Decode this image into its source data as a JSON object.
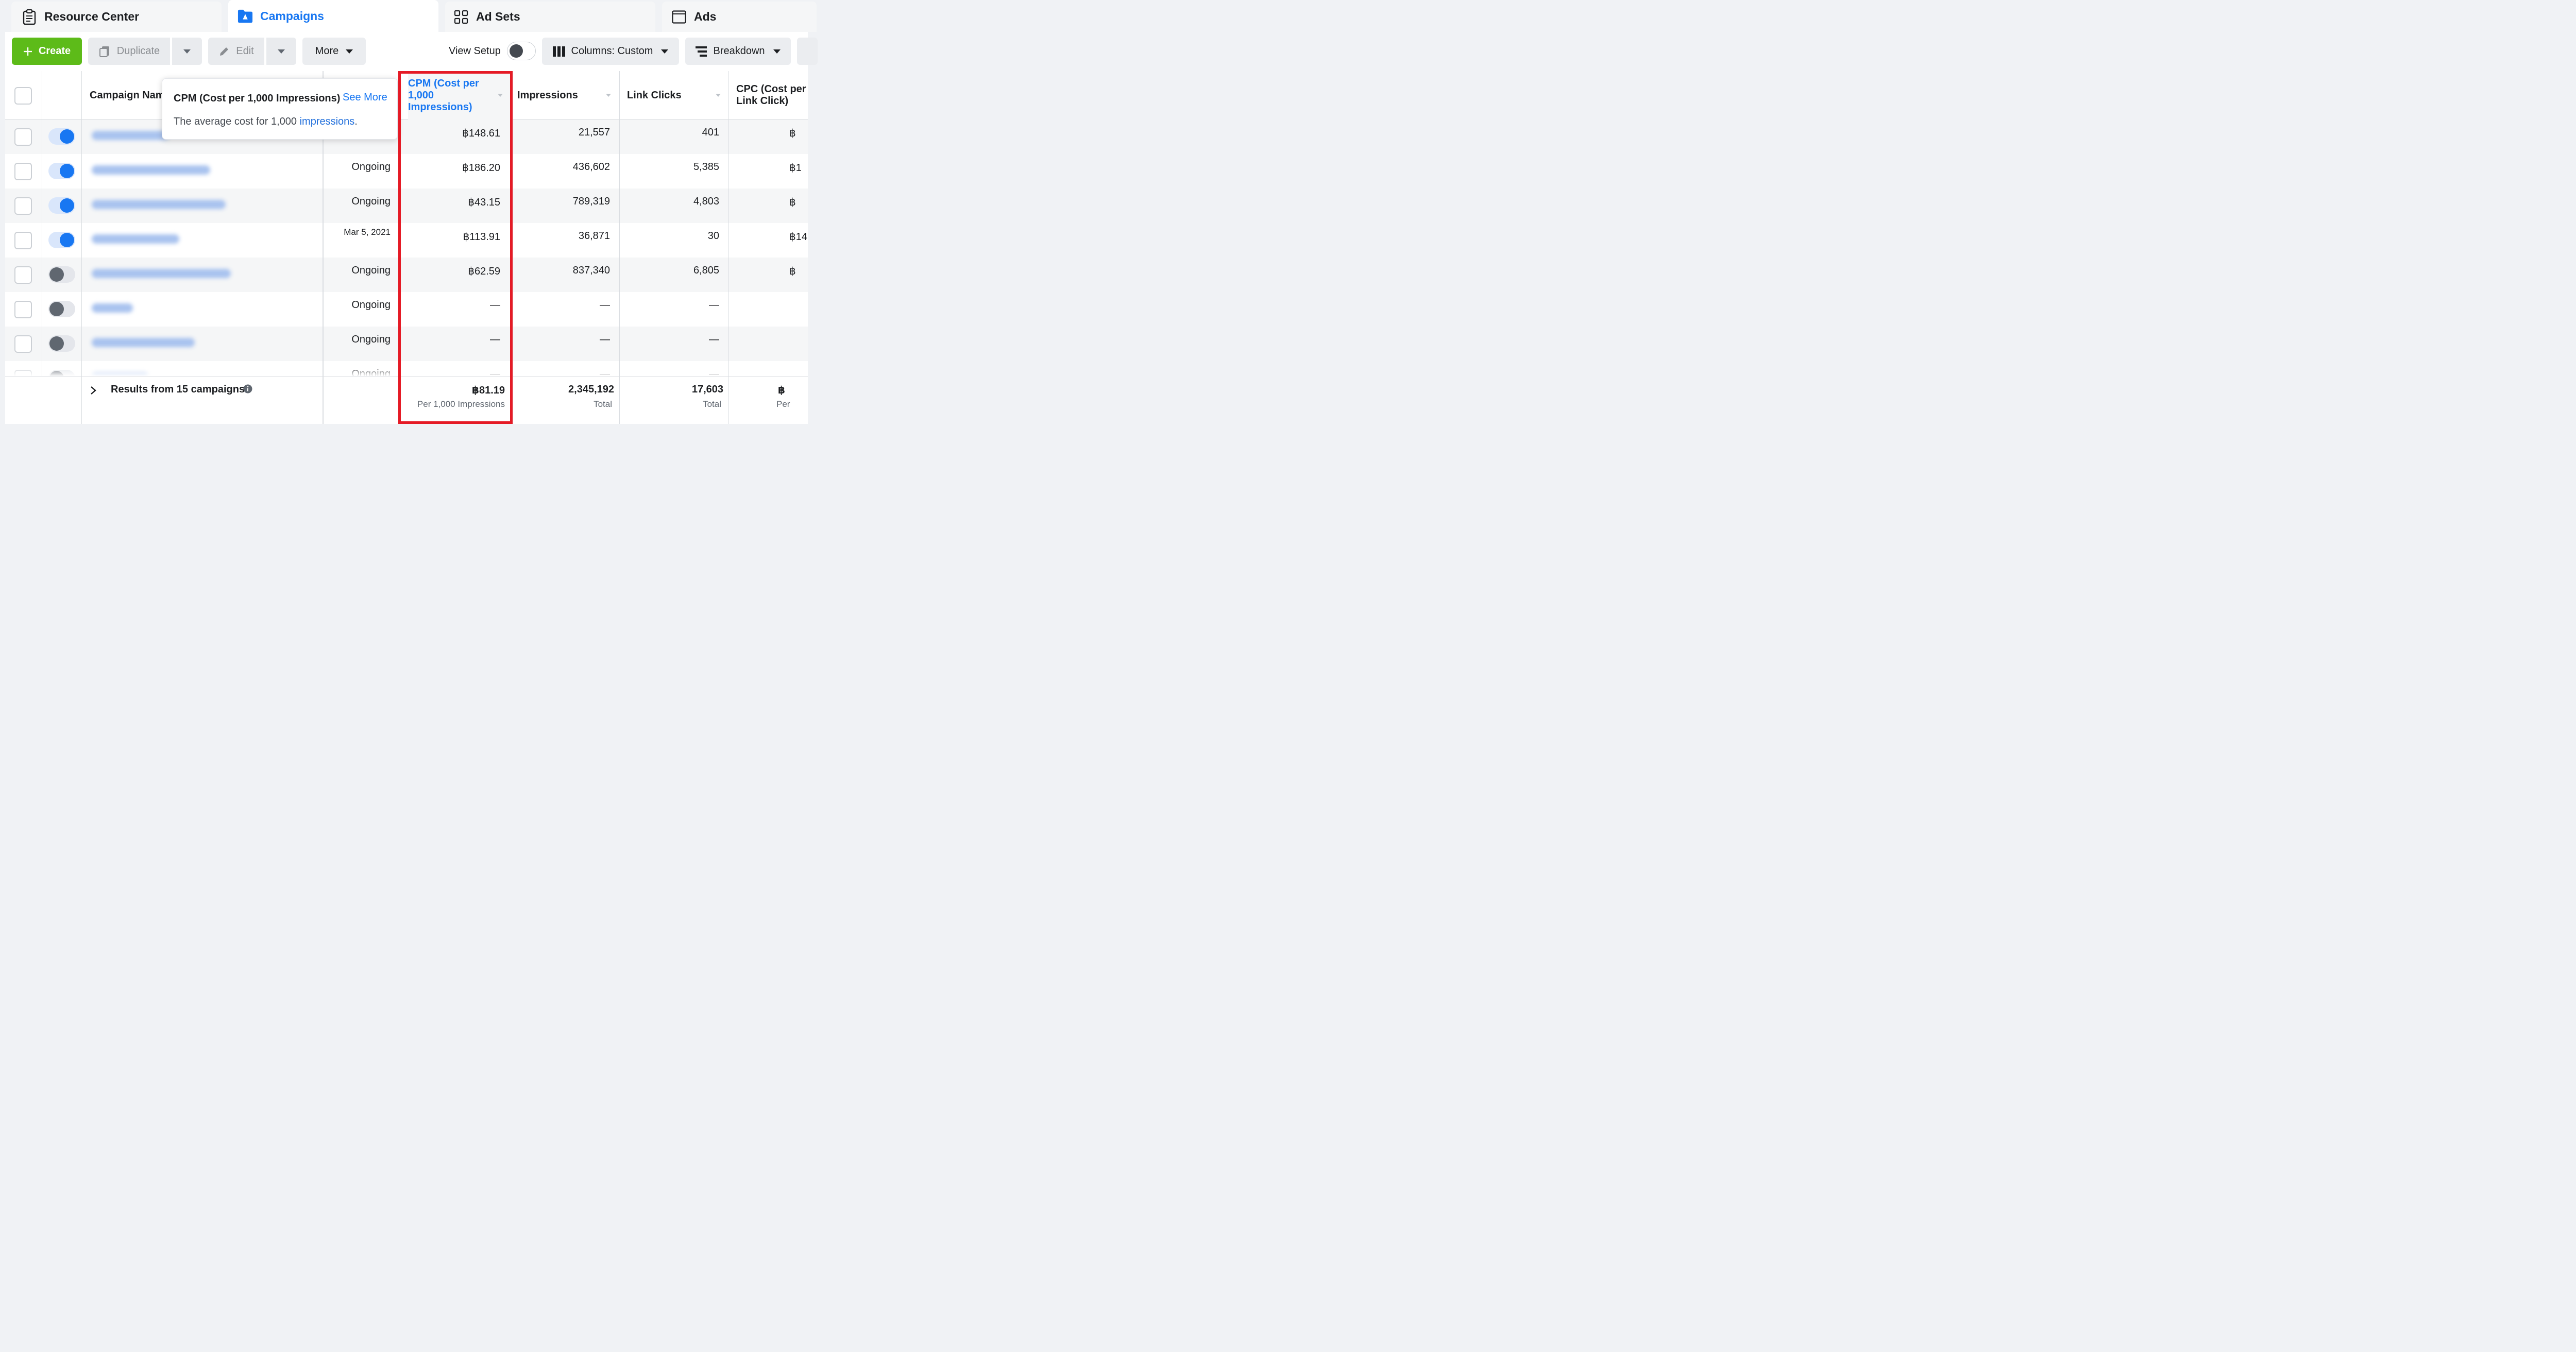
{
  "tabs": [
    {
      "label": "Resource Center",
      "icon": "clipboard-icon"
    },
    {
      "label": "Campaigns",
      "icon": "folder-icon"
    },
    {
      "label": "Ad Sets",
      "icon": "grid-icon"
    },
    {
      "label": "Ads",
      "icon": "window-icon"
    }
  ],
  "toolbar": {
    "create": "Create",
    "duplicate": "Duplicate",
    "edit": "Edit",
    "more": "More",
    "view_setup": "View Setup",
    "columns": "Columns: Custom",
    "breakdown": "Breakdown"
  },
  "table": {
    "headers": {
      "campaign_name": "Campaign Nam",
      "cpm": "CPM (Cost per 1,000 Impressions)",
      "impressions": "Impressions",
      "link_clicks": "Link Clicks",
      "cpc": "CPC (Cost per Link Click)"
    },
    "rows": [
      {
        "status": "",
        "cpm": "฿148.61",
        "impressions": "21,557",
        "link_clicks": "401",
        "cpc": "฿",
        "on": true
      },
      {
        "status": "Ongoing",
        "cpm": "฿186.20",
        "impressions": "436,602",
        "link_clicks": "5,385",
        "cpc": "฿1",
        "on": true
      },
      {
        "status": "Ongoing",
        "cpm": "฿43.15",
        "impressions": "789,319",
        "link_clicks": "4,803",
        "cpc": "฿",
        "on": true
      },
      {
        "status": "Mar 5, 2021",
        "cpm": "฿113.91",
        "impressions": "36,871",
        "link_clicks": "30",
        "cpc": "฿14",
        "on": true
      },
      {
        "status": "Ongoing",
        "cpm": "฿62.59",
        "impressions": "837,340",
        "link_clicks": "6,805",
        "cpc": "฿",
        "on": false
      },
      {
        "status": "Ongoing",
        "cpm": "—",
        "impressions": "—",
        "link_clicks": "—",
        "cpc": "",
        "on": false
      },
      {
        "status": "Ongoing",
        "cpm": "—",
        "impressions": "—",
        "link_clicks": "—",
        "cpc": "",
        "on": false
      },
      {
        "status": "Ongoing",
        "cpm": "—",
        "impressions": "—",
        "link_clicks": "—",
        "cpc": "",
        "on": false
      }
    ],
    "footer": {
      "results_label": "Results from 15 campaigns",
      "cpm": "฿81.19",
      "cpm_sub": "Per 1,000 Impressions",
      "impressions": "2,345,192",
      "impressions_sub": "Total",
      "link_clicks": "17,603",
      "link_clicks_sub": "Total",
      "cpc": "฿",
      "cpc_sub": "Per"
    }
  },
  "tooltip": {
    "title": "CPM (Cost per 1,000 Impressions)",
    "see_more": "See More",
    "desc_prefix": "The average cost for 1,000 ",
    "desc_link": "impressions",
    "desc_suffix": "."
  },
  "colors": {
    "accent": "#1877f2",
    "create_green": "#5dbb19",
    "highlight_red": "#e51a25"
  }
}
